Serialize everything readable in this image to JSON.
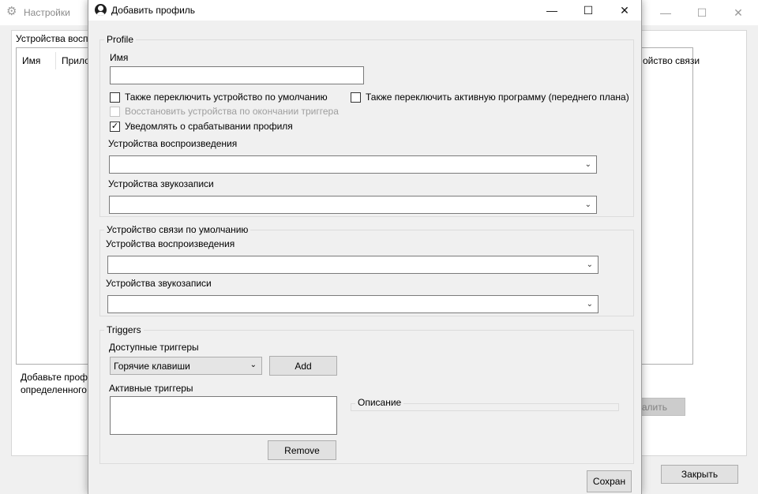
{
  "background_window": {
    "title": "Настройки",
    "gear_icon": "⚙",
    "tab_label": "Устройства восп",
    "columns": [
      "Имя",
      "Прило",
      "ойство связи"
    ],
    "info_line1": "Добавьте профи",
    "info_line2": "определенного",
    "delete_button": "алить",
    "close_button": "Закрыть",
    "caption": {
      "minimize": "—",
      "maximize": "☐",
      "close": "✕"
    }
  },
  "dialog": {
    "title": "Добавить профиль",
    "caption": {
      "minimize": "—",
      "maximize": "☐",
      "close": "✕"
    },
    "profile_group": {
      "legend": "Profile",
      "name_label": "Имя",
      "name_value": "",
      "checkboxes": [
        {
          "label": "Также переключить устройство по умолчанию",
          "checked": false,
          "disabled": false
        },
        {
          "label": "Также переключить активную программу (переднего плана)",
          "checked": false,
          "disabled": false
        },
        {
          "label": "Восстановить устройства по окончании триггера",
          "checked": false,
          "disabled": true
        },
        {
          "label": "Уведомлять о срабатывании профиля",
          "checked": true,
          "disabled": false
        }
      ],
      "playback_label": "Устройства воспроизведения",
      "playback_value": "",
      "recording_label": "Устройства звукозаписи",
      "recording_value": ""
    },
    "comm_group": {
      "legend": "Устройство связи по умолчанию",
      "playback_label": "Устройства воспроизведения",
      "playback_value": "",
      "recording_label": "Устройства звукозаписи",
      "recording_value": ""
    },
    "triggers_group": {
      "legend": "Triggers",
      "available_label": "Доступные триггеры",
      "available_selected": "Горячие клавиши",
      "add_button": "Add",
      "active_label": "Активные триггеры",
      "description_legend": "Описание",
      "remove_button": "Remove"
    },
    "save_button": "Сохран",
    "check_glyph": "✓",
    "chevron_glyph": "⌄"
  }
}
